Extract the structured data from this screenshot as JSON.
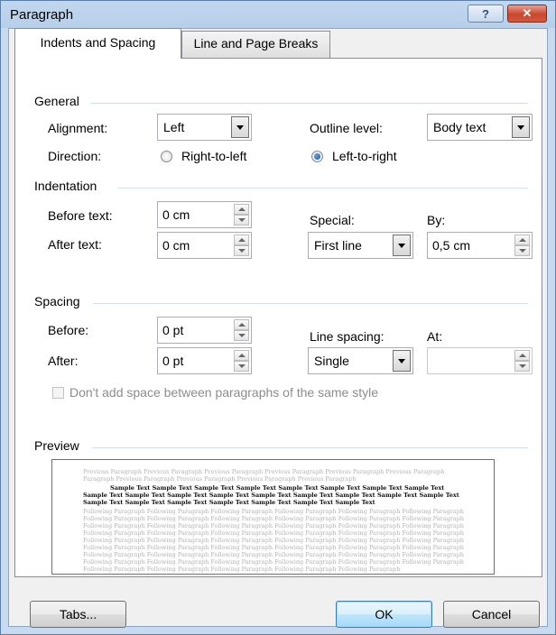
{
  "window": {
    "title": "Paragraph",
    "help_label": "?",
    "close_label": "✕"
  },
  "tabs": [
    {
      "label": "Indents and Spacing",
      "active": true
    },
    {
      "label": "Line and Page Breaks",
      "active": false
    }
  ],
  "general": {
    "title": "General",
    "alignment_label": "Alignment:",
    "alignment_value": "Left",
    "outline_label": "Outline level:",
    "outline_value": "Body text",
    "direction_label": "Direction:",
    "rtl_label": "Right-to-left",
    "ltr_label": "Left-to-right"
  },
  "indentation": {
    "title": "Indentation",
    "before_label": "Before text:",
    "before_value": "0 cm",
    "after_label": "After text:",
    "after_value": "0 cm",
    "special_label": "Special:",
    "special_value": "First line",
    "by_label": "By:",
    "by_value": "0,5 cm"
  },
  "spacing": {
    "title": "Spacing",
    "before_label": "Before:",
    "before_value": "0 pt",
    "after_label": "After:",
    "after_value": "0 pt",
    "line_spacing_label": "Line spacing:",
    "line_spacing_value": "Single",
    "at_label": "At:",
    "at_value": "",
    "dont_add_label": "Don't add space between paragraphs of the same style"
  },
  "preview": {
    "title": "Preview",
    "previous_lines": [
      "Previous Paragraph Previous Paragraph Previous Paragraph Previous Paragraph Previous Paragraph Previous Paragraph",
      "Paragraph Previous Paragraph Previous Paragraph Previous Paragraph Previous Paragraph"
    ],
    "sample_lines": [
      "Sample Text Sample Text Sample Text Sample Text Sample Text Sample Text Sample Text Sample Text",
      "Sample Text Sample Text Sample Text Sample Text Sample Text Sample Text Sample Text Sample Text Sample Text",
      "Sample Text Sample Text Sample Text Sample Text Sample Text Sample Text Sample Text"
    ],
    "following_lines": [
      "Following Paragraph Following Paragraph Following Paragraph Following Paragraph Following Paragraph Following Paragraph",
      "Following Paragraph Following Paragraph Following Paragraph Following Paragraph Following Paragraph Following Paragraph",
      "Following Paragraph Following Paragraph Following Paragraph Following Paragraph Following Paragraph Following Paragraph",
      "Following Paragraph Following Paragraph Following Paragraph Following Paragraph Following Paragraph Following Paragraph",
      "Following Paragraph Following Paragraph Following Paragraph Following Paragraph Following Paragraph Following Paragraph",
      "Following Paragraph Following Paragraph Following Paragraph Following Paragraph Following Paragraph Following Paragraph",
      "Following Paragraph Following Paragraph Following Paragraph Following Paragraph Following Paragraph Following Paragraph",
      "Following Paragraph Following Paragraph Following Paragraph Following Paragraph Following Paragraph Following Paragraph",
      "Following Paragraph Following Paragraph Following Paragraph Following Paragraph Following Paragraph"
    ]
  },
  "buttons": {
    "tabs_label": "Tabs...",
    "ok_label": "OK",
    "cancel_label": "Cancel"
  }
}
